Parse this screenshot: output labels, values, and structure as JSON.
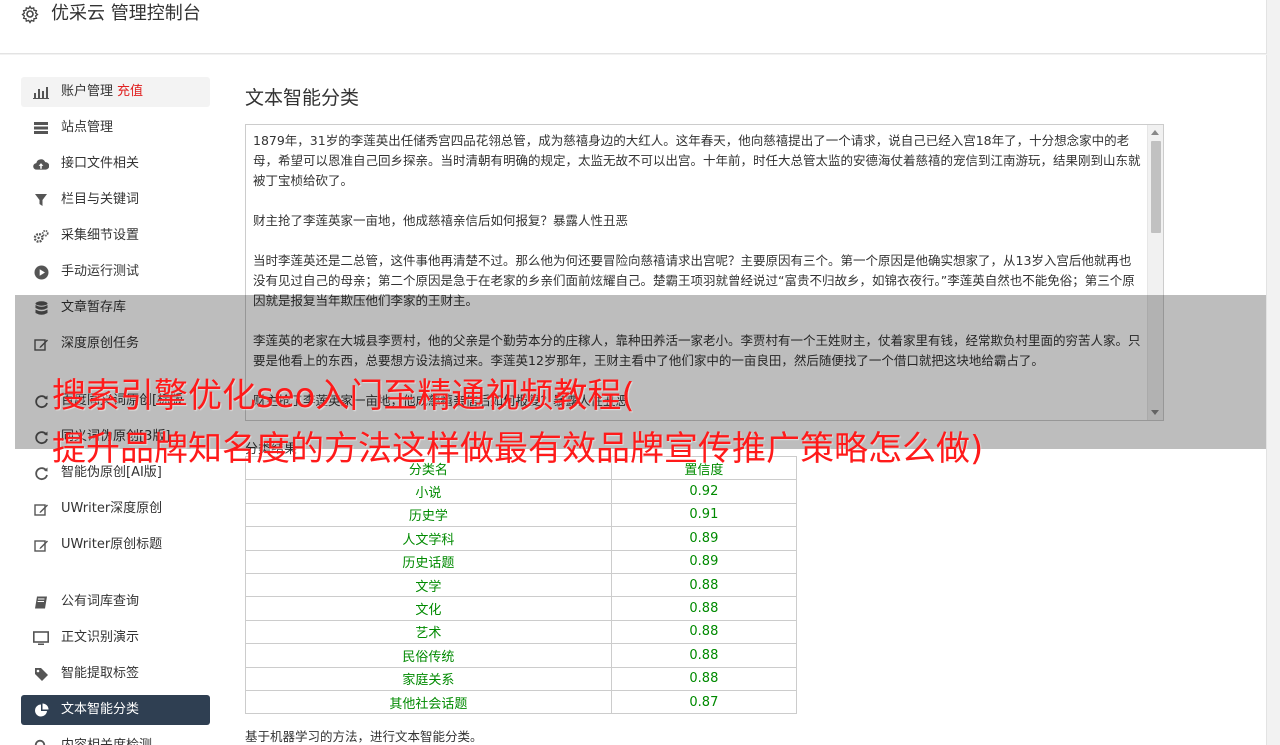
{
  "app": {
    "title": "优采云 管理控制台"
  },
  "sidebar": {
    "items": [
      {
        "label": "账户管理",
        "badge": "充值",
        "icon": "bar-chart-icon"
      },
      {
        "label": "站点管理",
        "icon": "server-icon"
      },
      {
        "label": "接口文件相关",
        "icon": "cloud-upload-icon"
      },
      {
        "label": "栏目与关键词",
        "icon": "filter-icon"
      },
      {
        "label": "采集细节设置",
        "icon": "gears-icon"
      },
      {
        "label": "手动运行测试",
        "icon": "play-circle-icon"
      },
      {
        "label": "文章暂存库",
        "icon": "database-icon"
      },
      {
        "label": "深度原创任务",
        "icon": "edit-icon"
      },
      {
        "label": "百度同义词原创[标版",
        "icon": "refresh-icon"
      },
      {
        "label": "同义词伪原创[3版]",
        "icon": "refresh-icon"
      },
      {
        "label": "智能伪原创[AI版]",
        "icon": "refresh-icon"
      },
      {
        "label": "UWriter深度原创",
        "icon": "edit-icon"
      },
      {
        "label": "UWriter原创标题",
        "icon": "edit-icon"
      },
      {
        "label": "公有词库查询",
        "icon": "book-icon"
      },
      {
        "label": "正文识别演示",
        "icon": "monitor-icon"
      },
      {
        "label": "智能提取标签",
        "icon": "tag-icon"
      },
      {
        "label": "文本智能分类",
        "icon": "pie-chart-icon"
      },
      {
        "label": "内容相关度检测",
        "icon": "search-icon"
      }
    ]
  },
  "main": {
    "title": "文本智能分类",
    "article": [
      "1879年，31岁的李莲英出任储秀宫四品花翎总管，成为慈禧身边的大红人。这年春天，他向慈禧提出了一个请求，说自己已经入宫18年了，十分想念家中的老母，希望可以恩准自己回乡探亲。当时清朝有明确的规定，太监无故不可以出宫。十年前，时任大总管太监的安德海仗着慈禧的宠信到江南游玩，结果刚到山东就被丁宝桢给砍了。",
      "财主抢了李莲英家一亩地，他成慈禧亲信后如何报复？暴露人性丑恶",
      "当时李莲英还是二总管，这件事他再清楚不过。那么他为何还要冒险向慈禧请求出宫呢？主要原因有三个。第一个原因是他确实想家了，从13岁入宫后他就再也没有见过自己的母亲；第二个原因是急于在老家的乡亲们面前炫耀自己。楚霸王项羽就曾经说过“富贵不归故乡，如锦衣夜行。”李莲英自然也不能免俗；第三个原因就是报复当年欺压他们李家的王财主。",
      "李莲英的老家在大城县李贾村，他的父亲是个勤劳本分的庄稼人，靠种田养活一家老小。李贾村有一个王姓财主，仗着家里有钱，经常欺负村里面的穷苦人家。只要是他看上的东西，总要想方设法搞过来。李莲英12岁那年，王财主看中了他们家中的一亩良田，然后随便找了一个借口就把这块地给霸占了。",
      "财主抢了李莲英家一亩地，他成慈禧亲信后如何报复？暴露人性丑恶"
    ],
    "result_label": "分类结果",
    "table": {
      "headers": [
        "分类名",
        "置信度"
      ],
      "rows": [
        [
          "小说",
          "0.92"
        ],
        [
          "历史学",
          "0.91"
        ],
        [
          "人文学科",
          "0.89"
        ],
        [
          "历史话题",
          "0.89"
        ],
        [
          "文学",
          "0.88"
        ],
        [
          "文化",
          "0.88"
        ],
        [
          "艺术",
          "0.88"
        ],
        [
          "民俗传统",
          "0.88"
        ],
        [
          "家庭关系",
          "0.88"
        ],
        [
          "其他社会话题",
          "0.87"
        ]
      ]
    },
    "footnote": "基于机器学习的方法，进行文本智能分类。"
  },
  "overlay": {
    "line1": "搜索引擎优化seo入门至精通视频教程(",
    "line2": "提升品牌知名度的方法这样做最有效品牌宣传推广策略怎么做)"
  },
  "colors": {
    "active_nav": "#2f3f52",
    "result_green": "#008a00",
    "overlay_red": "#ff1a1a",
    "badge_red": "#e02020"
  }
}
